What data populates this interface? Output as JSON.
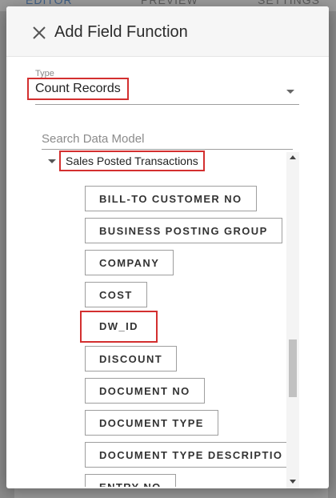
{
  "background": {
    "tabs": [
      "EDITOR",
      "PREVIEW",
      "SETTINGS"
    ]
  },
  "dialog": {
    "title": "Add Field Function",
    "close_icon": "close-icon",
    "type": {
      "label": "Type",
      "value": "Count Records"
    },
    "search": {
      "placeholder": "Search Data Model",
      "value": ""
    },
    "tree": {
      "root_label": "Sales Posted Transactions",
      "fields": [
        "BILL-TO CUSTOMER NO",
        "BUSINESS POSTING GROUP",
        "COMPANY",
        "COST",
        "DW_ID",
        "DISCOUNT",
        "DOCUMENT NO",
        "DOCUMENT TYPE",
        "DOCUMENT TYPE DESCRIPTIO",
        "ENTRY NO"
      ]
    }
  },
  "colors": {
    "highlight": "#d32f2f",
    "accent": "#3f5f86"
  }
}
